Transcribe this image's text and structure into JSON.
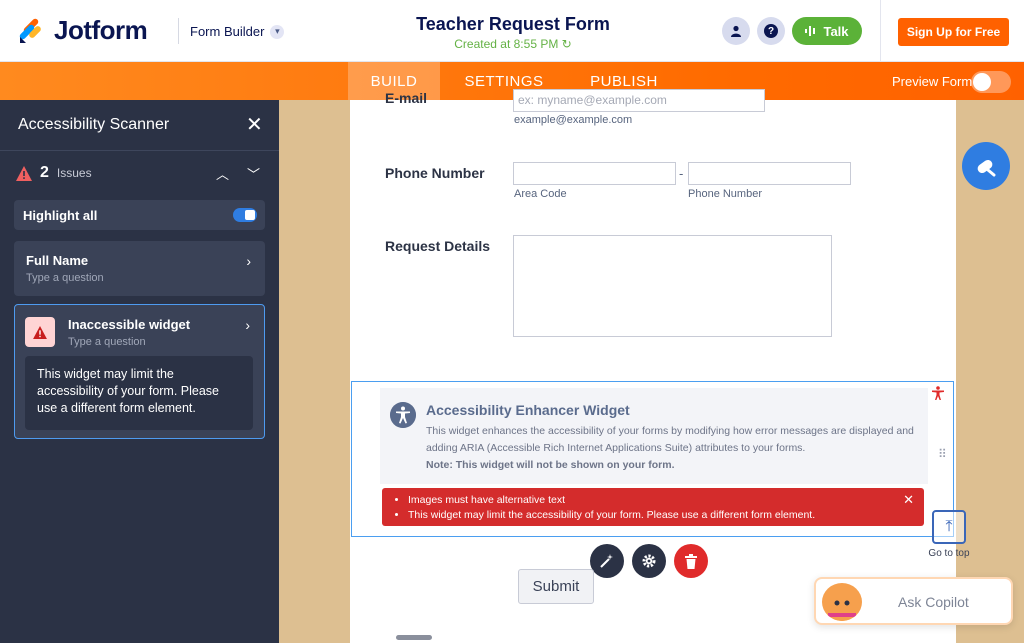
{
  "header": {
    "brand": "Jotform",
    "product": "Form Builder",
    "form_title": "Teacher Request Form",
    "created": "Created at 8:55 PM",
    "talk_label": "Talk",
    "signup_label": "Sign Up for Free"
  },
  "nav": {
    "tabs": [
      {
        "label": "BUILD",
        "active": true
      },
      {
        "label": "SETTINGS",
        "active": false
      },
      {
        "label": "PUBLISH",
        "active": false
      }
    ],
    "preview_label": "Preview Form"
  },
  "scanner": {
    "title": "Accessibility Scanner",
    "issue_count": "2",
    "issue_label": "Issues",
    "highlight_label": "Highlight all",
    "items": [
      {
        "title": "Full Name",
        "subtitle": "Type a question"
      },
      {
        "title": "Inaccessible widget",
        "subtitle": "Type a question",
        "message": "This widget may limit the accessibility of your form. Please use a different form element."
      }
    ]
  },
  "form": {
    "email": {
      "label": "E-mail",
      "placeholder": "ex: myname@example.com",
      "sublabel": "example@example.com"
    },
    "phone": {
      "label": "Phone Number",
      "separator": "-",
      "area_sublabel": "Area Code",
      "number_sublabel": "Phone Number"
    },
    "details": {
      "label": "Request Details"
    },
    "widget": {
      "title": "Accessibility Enhancer Widget",
      "description": "This widget enhances the accessibility of your forms by modifying how error messages are displayed and adding ARIA (Accessible Rich Internet Applications Suite) attributes to your forms.",
      "note": "Note: This widget will not be shown on your form.",
      "errors": [
        "Images must have alternative text",
        "This widget may limit the accessibility of your form. Please use a different form element."
      ]
    },
    "submit_label": "Submit"
  },
  "floating": {
    "goto_top": "Go to top",
    "copilot": "Ask Copilot"
  },
  "colors": {
    "brand_orange": "#ff6100",
    "panel_bg": "#2b3245",
    "accent_blue": "#2f7de1",
    "error_red": "#d42c2c",
    "success_green": "#5bb238"
  }
}
